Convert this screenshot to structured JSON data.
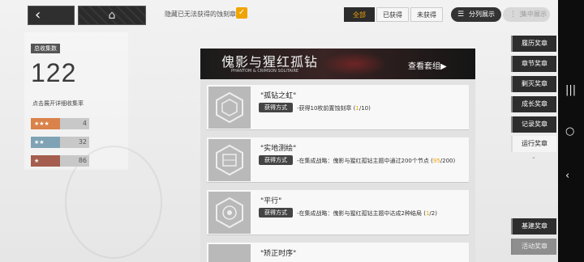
{
  "topbar": {
    "back_icon": "‹",
    "home_icon": "⌂",
    "hide_label": "隐藏已无法获得的蚀刻章",
    "hide_checked": true,
    "filters": [
      "全部",
      "已获得",
      "未获得"
    ],
    "filter_active": 0,
    "view_split": "分列展示",
    "view_merge": "集中展示"
  },
  "stats": {
    "label": "总收集数",
    "count": "122",
    "sub": "点击展开详细收集率",
    "tiers": [
      {
        "stars": "★★★",
        "count": "4",
        "color": "#d9824a"
      },
      {
        "stars": "★★",
        "count": "32",
        "color": "#7fa3b5"
      },
      {
        "stars": "★",
        "count": "86",
        "color": "#a45d4e"
      }
    ]
  },
  "banner": {
    "title": "傀影与猩红孤钻",
    "subtitle": "PHANTOM & CRIMSON SOLITAIRE",
    "link": "查看套组▶"
  },
  "medals": [
    {
      "title": "\"孤钻之虹\"",
      "tag": "获得方式",
      "desc": "-获得10枚前置蚀刻章",
      "prog_done": "1",
      "prog_total": "/10)",
      "prog_open": "("
    },
    {
      "title": "\"实地测绘\"",
      "tag": "获得方式",
      "desc": "-在集成战略：傀影与猩红孤钻主题中通过200个节点",
      "prog_done": "95",
      "prog_total": "/200)",
      "prog_open": "("
    },
    {
      "title": "\"平行\"",
      "tag": "获得方式",
      "desc": "-在集成战略：傀影与猩红孤钻主题中达成2种结局",
      "prog_done": "1",
      "prog_total": "/2)",
      "prog_open": "("
    },
    {
      "title": "\"矫正时序\"",
      "tag": "",
      "desc": "",
      "prog_done": "",
      "prog_total": "",
      "prog_open": ""
    }
  ],
  "nav": {
    "items": [
      "履历奖章",
      "章节奖章",
      "剿灭奖章",
      "成长奖章",
      "记录奖章",
      "运行奖章"
    ],
    "active": 5,
    "bottom": [
      "基建奖章",
      "活动奖章"
    ]
  },
  "colors": {
    "accent": "#f0a400",
    "dark": "#2d2d2d"
  }
}
